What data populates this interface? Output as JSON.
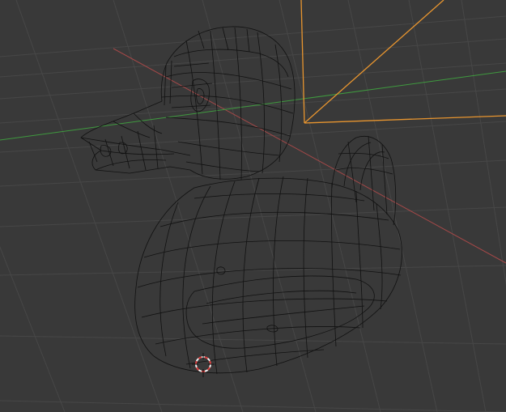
{
  "viewport": {
    "background_color": "#393939",
    "grid_color": "#474747",
    "x_axis_color": "#a34848",
    "y_axis_color": "#3f9a3f",
    "wire_color": "#111111",
    "camera_color": "#e8952f",
    "cursor_color": "#e04040",
    "cursor_ring_color": "#f2f2f2"
  },
  "objects": [
    {
      "name": "duck-mesh",
      "display": "wireframe"
    },
    {
      "name": "camera",
      "state": "selected"
    }
  ],
  "icons": {
    "cursor": "3d-cursor-icon"
  }
}
